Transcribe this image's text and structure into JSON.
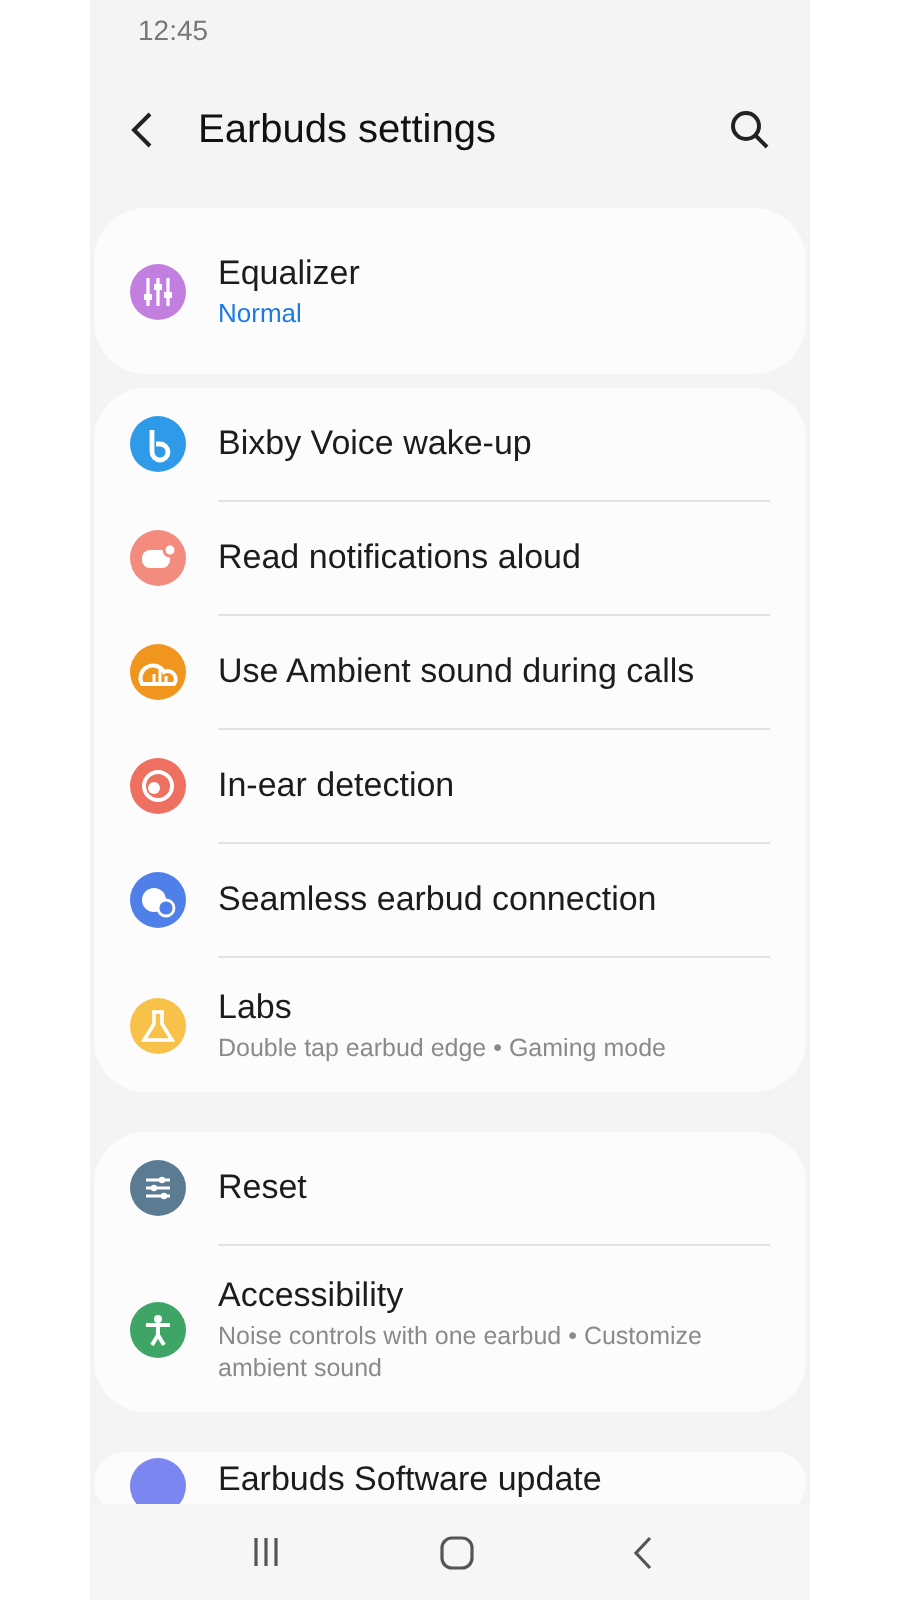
{
  "status_bar": {
    "time": "12:45"
  },
  "header": {
    "title": "Earbuds settings"
  },
  "sections": [
    {
      "items": [
        {
          "title": "Equalizer",
          "subtitle": "Normal",
          "kind": "value"
        }
      ]
    },
    {
      "items": [
        {
          "title": "Bixby Voice wake-up"
        },
        {
          "title": "Read notifications aloud"
        },
        {
          "title": "Use Ambient sound during calls"
        },
        {
          "title": "In-ear detection"
        },
        {
          "title": "Seamless earbud connection"
        },
        {
          "title": "Labs",
          "subtitle": "Double tap earbud edge • Gaming mode",
          "kind": "summary"
        }
      ]
    },
    {
      "items": [
        {
          "title": "Reset"
        },
        {
          "title": "Accessibility",
          "subtitle": "Noise controls with one earbud • Customize ambient sound",
          "kind": "summary"
        }
      ]
    },
    {
      "items": [
        {
          "title": "Earbuds Software update"
        }
      ]
    }
  ]
}
